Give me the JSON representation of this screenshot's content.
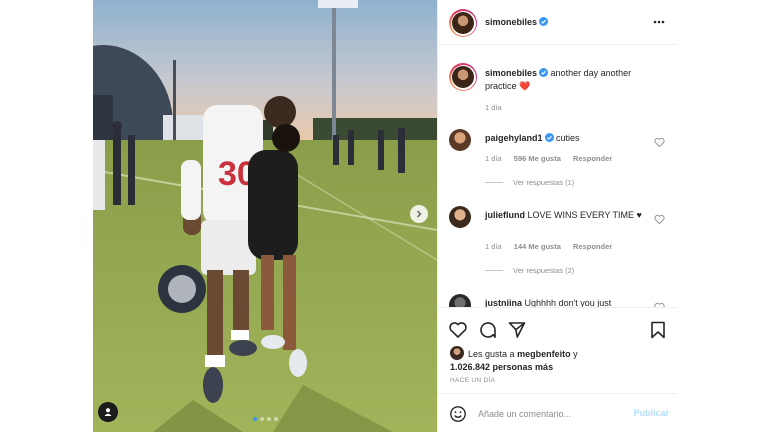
{
  "post": {
    "username": "simonebiles",
    "verified": true,
    "menu_icon": "more-horizontal-icon"
  },
  "photo": {
    "jersey_number": "30",
    "dots": 4,
    "active_dot": 1,
    "next_icon": "chevron-right-icon",
    "tag_icon": "user-tag-icon"
  },
  "caption": {
    "username": "simonebiles",
    "text": "another day another practice",
    "emoji": "❤️",
    "time": "1 día"
  },
  "comments": [
    {
      "username": "paigehyland1",
      "verified": true,
      "text": "cuties",
      "time": "1 día",
      "likes": "596 Me gusta",
      "reply_label": "Responder",
      "view_replies": "Ver respuestas (1)"
    },
    {
      "username": "julieflund",
      "verified": false,
      "text": "LOVE WINS EVERY TIME ♥",
      "time": "1 día",
      "likes": "144 Me gusta",
      "reply_label": "Responder",
      "view_replies": "Ver respuestas (2)"
    },
    {
      "username": "justniina",
      "verified": false,
      "text": "Ughhhh don't you just",
      "time": "",
      "likes": "",
      "reply_label": "",
      "view_replies": ""
    }
  ],
  "actions": {
    "like_icon": "heart-icon",
    "comment_icon": "comment-icon",
    "share_icon": "paper-plane-icon",
    "save_icon": "bookmark-icon"
  },
  "likes_summary": {
    "prefix": "Les gusta a",
    "user": "megbenfeito",
    "connector": "y",
    "count": "1.026.842 personas más"
  },
  "timestamp": "HACE UN DÍA",
  "add_comment": {
    "placeholder": "Añade un comentario...",
    "post_label": "Publicar",
    "emoji_icon": "smiley-icon"
  },
  "colors": {
    "verified": "#3897f0",
    "link_disabled": "#b2dffc",
    "muted_text": "#8e8e8e",
    "heart_red": "#ed4956"
  }
}
